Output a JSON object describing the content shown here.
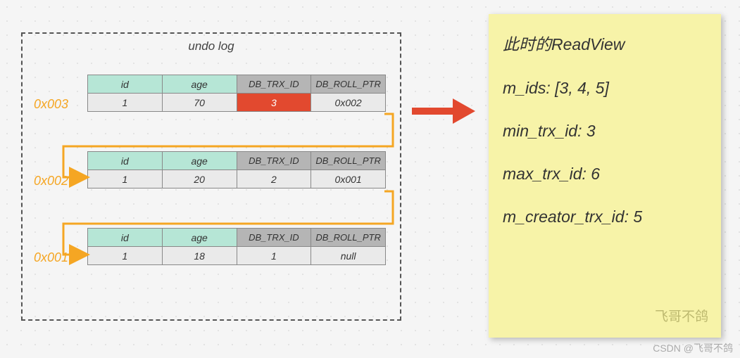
{
  "undo": {
    "title": "undo log",
    "columns": {
      "id": "id",
      "age": "age",
      "trx": "DB_TRX_ID",
      "ptr": "DB_ROLL_PTR"
    },
    "records": [
      {
        "addr": "0x003",
        "id": "1",
        "age": "70",
        "trx": "3",
        "ptr": "0x002",
        "highlight_trx": true
      },
      {
        "addr": "0x002",
        "id": "1",
        "age": "20",
        "trx": "2",
        "ptr": "0x001",
        "highlight_trx": false
      },
      {
        "addr": "0x001",
        "id": "1",
        "age": "18",
        "trx": "1",
        "ptr": "null",
        "highlight_trx": false
      }
    ]
  },
  "readview": {
    "title": "此时的ReadView",
    "m_ids": "m_ids:  [3, 4, 5]",
    "min_trx_id": "min_trx_id: 3",
    "max_trx_id": "max_trx_id: 6",
    "creator": "m_creator_trx_id: 5",
    "sig": "飞哥不鸽"
  },
  "watermark": "CSDN @飞哥不鸽",
  "colors": {
    "arrow_orange": "#f5a623",
    "arrow_red": "#e2492f"
  }
}
